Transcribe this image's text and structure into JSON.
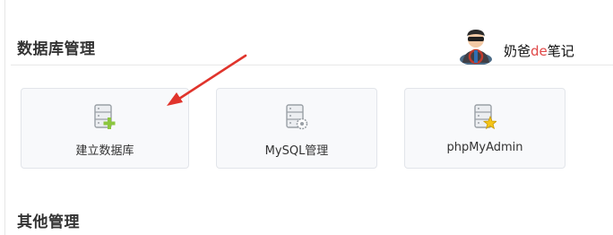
{
  "sections": [
    {
      "title": "数据库管理"
    },
    {
      "title": "其他管理"
    }
  ],
  "cards": [
    {
      "label": "建立数据库",
      "icon": "database-add-icon"
    },
    {
      "label": "MySQL管理",
      "icon": "database-settings-icon"
    },
    {
      "label": "phpMyAdmin",
      "icon": "database-star-icon"
    }
  ],
  "watermark": {
    "prefix": "奶爸",
    "highlight": "de",
    "suffix": "笔记",
    "icon": "driver-avatar-icon"
  },
  "annotation": {
    "icon": "red-arrow-icon",
    "color": "#e0342c"
  },
  "colors": {
    "add_green": "#8cc63f",
    "star_yellow": "#f5c518",
    "db_gray": "#b4b9bf"
  }
}
